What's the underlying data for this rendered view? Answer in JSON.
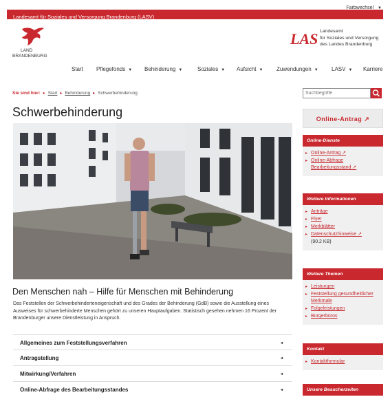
{
  "topbar": {
    "farbwechsel": "Farbwechsel"
  },
  "header": {
    "agency": "Landesamt für Soziales und Versorgung Brandenburg (LASV)",
    "logo_left": {
      "line1": "LAND",
      "line2": "BRANDENBURG"
    },
    "logo_right": {
      "mark": "LASV",
      "line1": "Landesamt",
      "line2": "für Soziales und Versorgung",
      "line3": "des Landes Brandenburg"
    }
  },
  "nav": {
    "items": [
      {
        "label": "Start"
      },
      {
        "label": "Pflegefonds"
      },
      {
        "label": "Behinderung"
      },
      {
        "label": "Soziales"
      },
      {
        "label": "Aufsicht"
      },
      {
        "label": "Zuwendungen"
      },
      {
        "label": "LASV"
      },
      {
        "label": "Karriere"
      }
    ],
    "caret": "▼"
  },
  "breadcrumb": {
    "prefix": "Sie sind hier:",
    "sep": "▸",
    "items": [
      "Start",
      "Behinderung",
      "Schwerbehinderung"
    ]
  },
  "search": {
    "placeholder": "Suchbegriffe"
  },
  "page": {
    "title": "Schwerbehinderung",
    "subtitle": "Den Menschen nah – Hilfe für Menschen mit Behinderung",
    "intro": "Das Feststellen der Schwerbehinderteneigenschaft und des Grades der Behinderung (GdB) sowie die Ausstellung eines Ausweises für schwerbehinderte Menschen gehört zu unseren Hauptaufgaben. Statistisch gesehen nehmen 16 Prozent der Brandenburger unsere Dienstleistung in Anspruch.",
    "accordion": [
      {
        "label": "Allgemeines zum Feststellungsverfahren"
      },
      {
        "label": "Antragstellung"
      },
      {
        "label": "Mitwirkung/Verfahren"
      },
      {
        "label": "Online-Abfrage des Bearbeitungsstandes"
      }
    ],
    "acc_arrow": "◂"
  },
  "sidebar": {
    "online_button": "Online-Antrag ↗",
    "online_dienste": {
      "title": "Online-Dienste",
      "items": [
        "Online-Antrag ↗",
        "Online-Abfrage Bearbeitungsstand ↗"
      ]
    },
    "weitere_infos": {
      "title": "Weitere Informationen",
      "items": [
        "Anträge",
        "Flyer",
        "Merkblätter",
        "Datenschutzhinweise ↗"
      ],
      "size_note": "(90.2 KB)"
    },
    "weitere_themen": {
      "title": "Weitere Themen",
      "items": [
        "Leistungen",
        "Feststellung gesundheitlicher Merkmale",
        "Folgeleistungen",
        "Bürgerbüros"
      ]
    },
    "kontakt": {
      "title": "Kontakt",
      "items": [
        "Kontaktformular"
      ]
    },
    "besucherzeiten": {
      "title": "Unsere Besucherzeiten"
    }
  },
  "colors": {
    "brand_red": "#c8282e"
  }
}
